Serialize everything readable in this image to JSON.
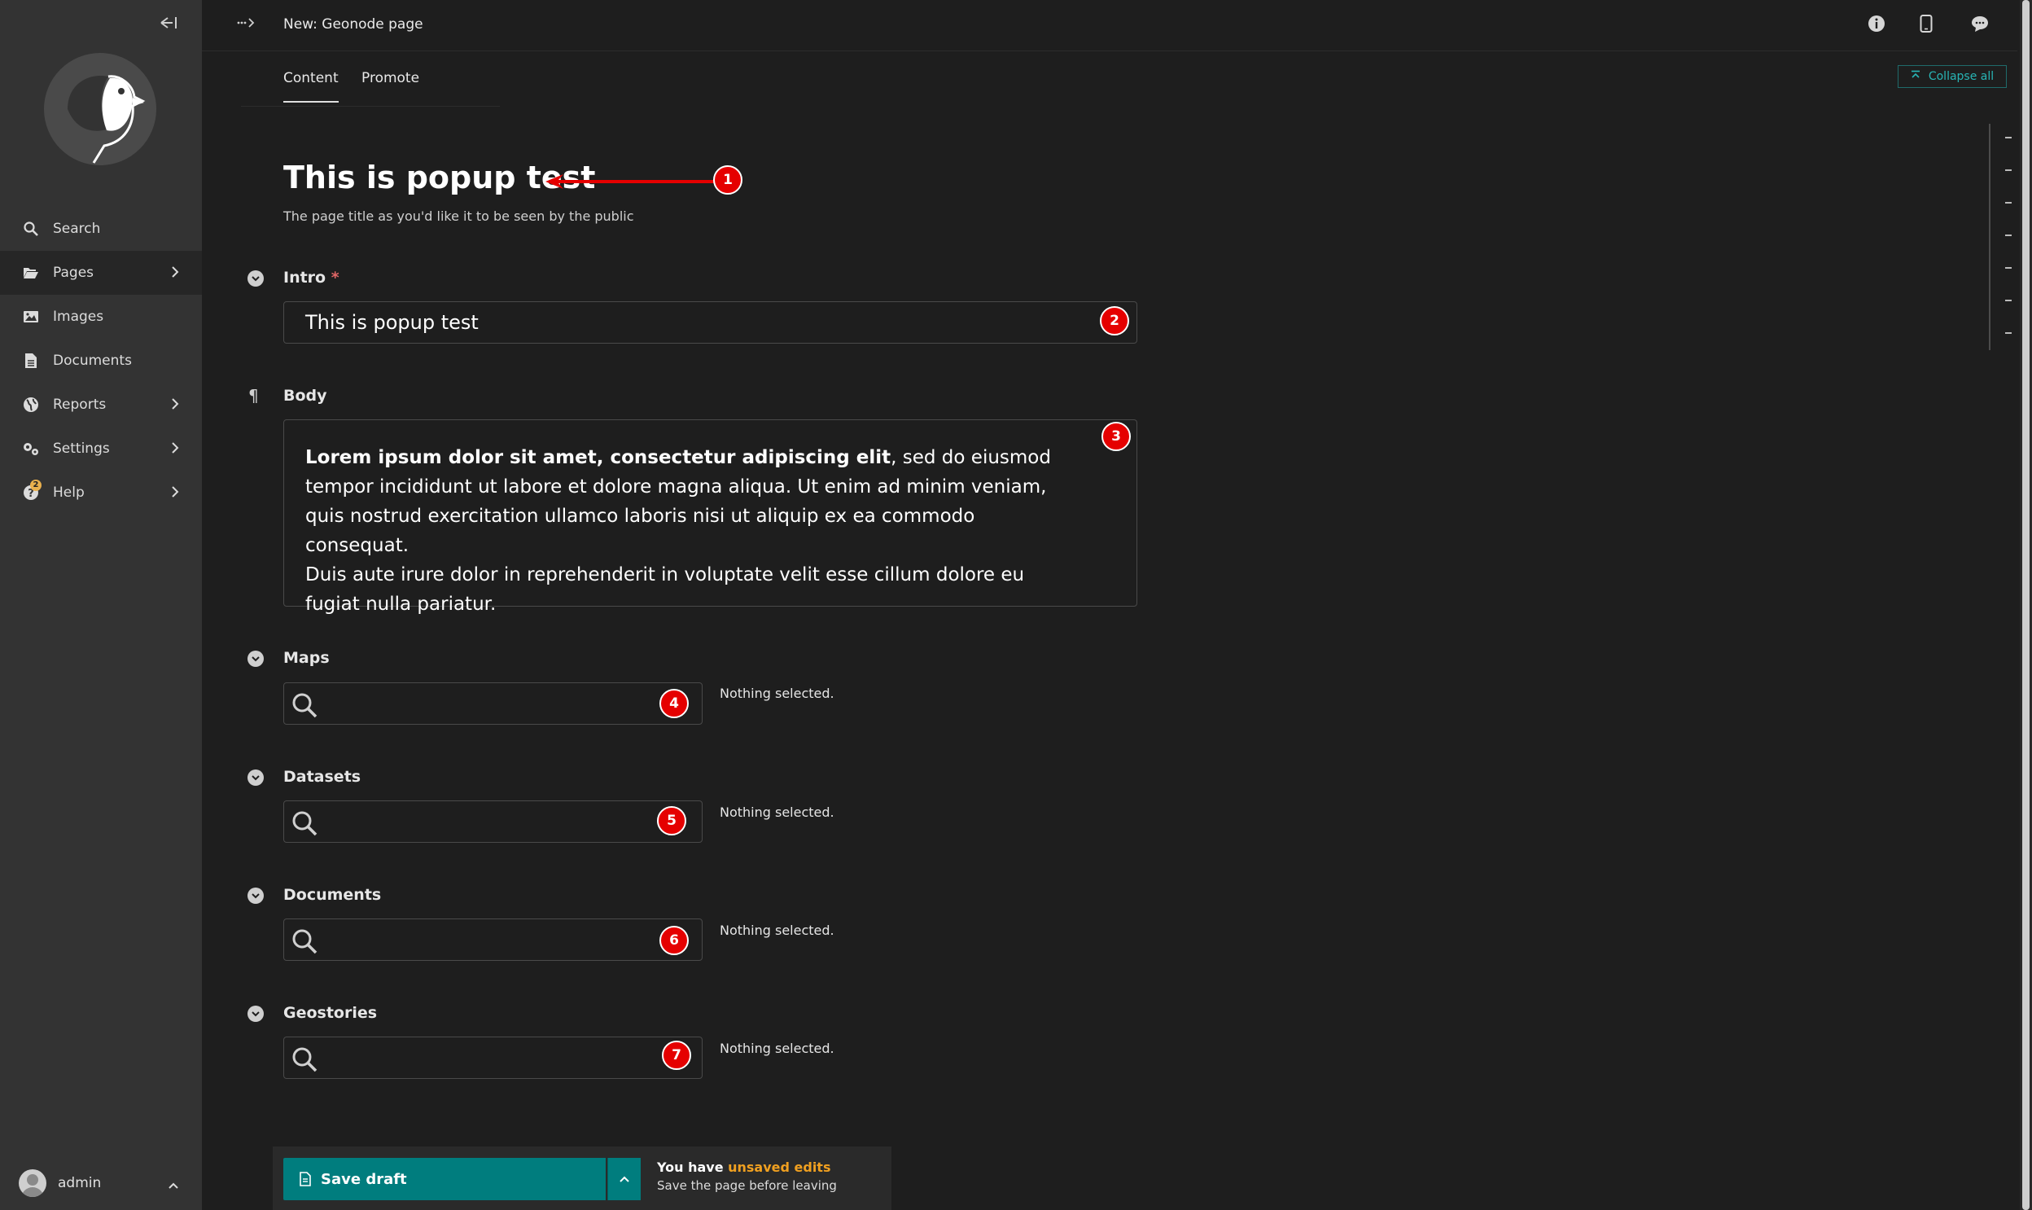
{
  "header": {
    "breadcrumb_icon": "breadcrumb-dots-icon",
    "title": "New: Geonode page",
    "icons": [
      "info-icon",
      "mobile-preview-icon",
      "comment-icon"
    ]
  },
  "sidebar": {
    "collapse_icon": "collapse-sidebar-icon",
    "logo": "wagtail-bird-logo",
    "items": [
      {
        "label": "Search",
        "icon": "search-icon"
      },
      {
        "label": "Pages",
        "icon": "folder-open-icon"
      },
      {
        "label": "Images",
        "icon": "image-icon"
      },
      {
        "label": "Documents",
        "icon": "document-icon"
      },
      {
        "label": "Reports",
        "icon": "globe-icon"
      },
      {
        "label": "Settings",
        "icon": "cogs-icon"
      },
      {
        "label": "Help",
        "icon": "help-icon",
        "badge": "2"
      }
    ],
    "user": {
      "name": "admin"
    }
  },
  "tabs": [
    {
      "label": "Content"
    },
    {
      "label": "Promote"
    }
  ],
  "collapse_all_label": "Collapse all",
  "page": {
    "title": "This is popup test",
    "title_help": "The page title as you'd like it to be seen by the public"
  },
  "fields": {
    "intro": {
      "label": "Intro",
      "required_mark": "*",
      "value": "This is popup test"
    },
    "body": {
      "label": "Body",
      "bold": "Lorem ipsum dolor sit amet, consectetur adipiscing elit",
      "rest_line1": ", sed do eiusmod tempor incididunt ut labore et dolore magna aliqua. Ut enim ad minim veniam, quis nostrud exercitation ullamco laboris nisi ut aliquip ex ea commodo consequat.",
      "line2": "Duis aute irure dolor in reprehenderit in voluptate velit esse cillum dolore eu fugiat nulla pariatur."
    },
    "maps": {
      "label": "Maps",
      "status": "Nothing selected."
    },
    "datasets": {
      "label": "Datasets",
      "status": "Nothing selected."
    },
    "documents": {
      "label": "Documents",
      "status": "Nothing selected."
    },
    "geostories": {
      "label": "Geostories",
      "status": "Nothing selected."
    }
  },
  "annotations": [
    "1",
    "2",
    "3",
    "4",
    "5",
    "6",
    "7"
  ],
  "footer": {
    "save_label": "Save draft",
    "unsaved_prefix": "You have ",
    "unsaved_highlight": "unsaved edits",
    "unsaved_sub": "Save the page before leaving"
  },
  "colors": {
    "accent": "#007d7e",
    "marker": "#e50000",
    "warning": "#f0a020",
    "sidebar_bg": "#333333",
    "page_bg": "#1e1e1e"
  }
}
